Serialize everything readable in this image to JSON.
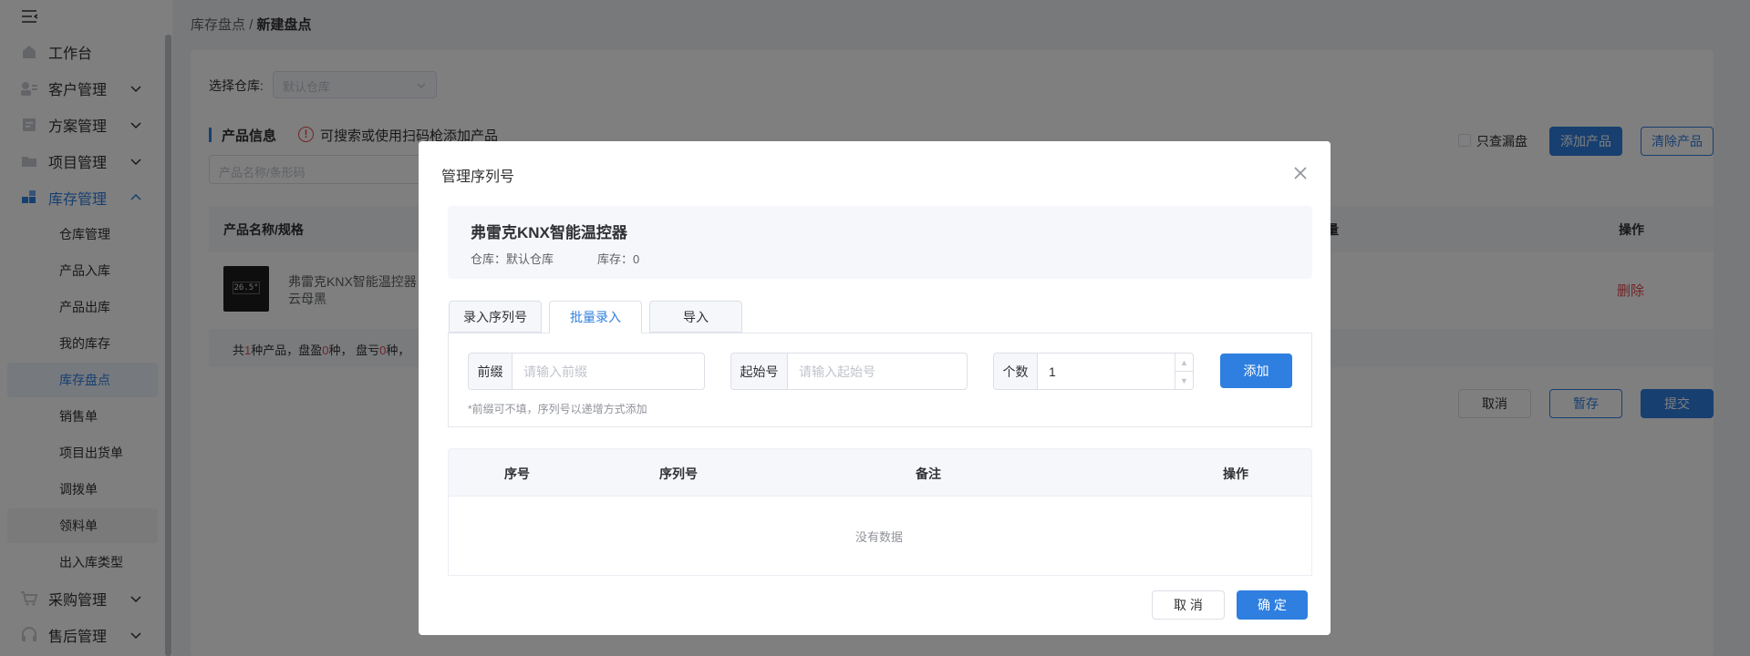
{
  "sidebar": {
    "items": [
      {
        "label": "工作台",
        "icon": "home-icon"
      },
      {
        "label": "客户管理",
        "icon": "customer-icon"
      },
      {
        "label": "方案管理",
        "icon": "plan-icon"
      },
      {
        "label": "项目管理",
        "icon": "folder-icon"
      },
      {
        "label": "库存管理",
        "icon": "inventory-icon"
      }
    ],
    "sub_items": [
      "仓库管理",
      "产品入库",
      "产品出库",
      "我的库存",
      "库存盘点",
      "销售单",
      "项目出货单",
      "调拨单",
      "领料单",
      "出入库类型"
    ],
    "bottom_items": [
      {
        "label": "采购管理",
        "icon": "cart-icon"
      },
      {
        "label": "售后管理",
        "icon": "headset-icon"
      }
    ]
  },
  "breadcrumb": {
    "parent": "库存盘点",
    "separator": "/",
    "current": "新建盘点"
  },
  "page": {
    "warehouse_label": "选择仓库:",
    "warehouse_value": "默认仓库",
    "section_title": "产品信息",
    "warn_text": "可搜索或使用扫码枪添加产品",
    "search_placeholder": "产品名称/条形码",
    "only_missed_label": "只查漏盘",
    "add_product": "添加产品",
    "clear_product": "清除产品",
    "columns": {
      "name": "产品名称/规格",
      "quantity": "数量",
      "action": "操作"
    },
    "row": {
      "name": "弗雷克KNX智能温控器",
      "spec": "云母黑",
      "screen": "26.5°",
      "delete": "删除"
    },
    "summary": {
      "a": "共",
      "n1": "1",
      "b": "种产品，盘盈",
      "n2": "0",
      "c": "种，  盘亏",
      "n3": "0",
      "d": "种，"
    },
    "cancel": "取消",
    "save": "暂存",
    "submit": "提交"
  },
  "dialog": {
    "title": "管理序列号",
    "product_name": "弗雷克KNX智能温控器",
    "warehouse_text": "仓库：默认仓库",
    "stock_text": "库存：0",
    "tabs": [
      "录入序列号",
      "批量录入",
      "导入"
    ],
    "active_tab": 1,
    "prefix_label": "前缀",
    "prefix_placeholder": "请输入前缀",
    "start_label": "起始号",
    "start_placeholder": "请输入起始号",
    "count_label": "个数",
    "count_value": "1",
    "add_button": "添加",
    "hint": "*前缀可不填，序列号以递增方式添加",
    "table_columns": [
      "序号",
      "序列号",
      "备注",
      "操作"
    ],
    "empty_text": "没有数据",
    "cancel": "取 消",
    "confirm": "确 定"
  },
  "colors": {
    "primary": "#2f7fe0",
    "danger": "#e5484d"
  }
}
